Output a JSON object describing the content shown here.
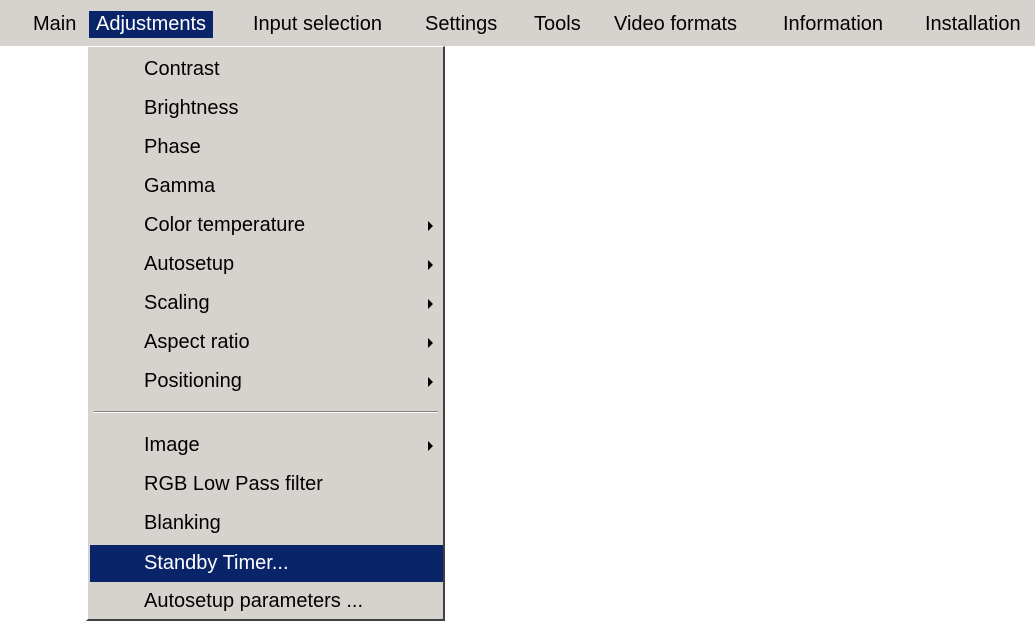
{
  "menubar": {
    "items": [
      {
        "label": "Main",
        "active": false
      },
      {
        "label": "Adjustments",
        "active": true
      },
      {
        "label": "Input selection",
        "active": false
      },
      {
        "label": "Settings",
        "active": false
      },
      {
        "label": "Tools",
        "active": false
      },
      {
        "label": "Video formats",
        "active": false
      },
      {
        "label": "Information",
        "active": false
      },
      {
        "label": "Installation",
        "active": false
      }
    ]
  },
  "dropdown": {
    "group1": [
      {
        "label": "Contrast",
        "submenu": false
      },
      {
        "label": "Brightness",
        "submenu": false
      },
      {
        "label": "Phase",
        "submenu": false
      },
      {
        "label": "Gamma",
        "submenu": false
      },
      {
        "label": "Color temperature",
        "submenu": true
      },
      {
        "label": "Autosetup",
        "submenu": true
      },
      {
        "label": "Scaling",
        "submenu": true
      },
      {
        "label": "Aspect ratio",
        "submenu": true
      },
      {
        "label": "Positioning",
        "submenu": true
      }
    ],
    "group2": [
      {
        "label": "Image",
        "submenu": true
      },
      {
        "label": "RGB Low Pass filter",
        "submenu": false
      },
      {
        "label": "Blanking",
        "submenu": false
      },
      {
        "label": "Standby Timer...",
        "submenu": false,
        "highlighted": true
      },
      {
        "label": "Autosetup parameters ...",
        "submenu": false
      }
    ]
  },
  "colors": {
    "menu_background": "#d6d3ce",
    "selection": "#0a246a",
    "selection_text": "#ffffff"
  },
  "icons": {
    "submenu_arrow": "submenu-arrow-icon"
  }
}
